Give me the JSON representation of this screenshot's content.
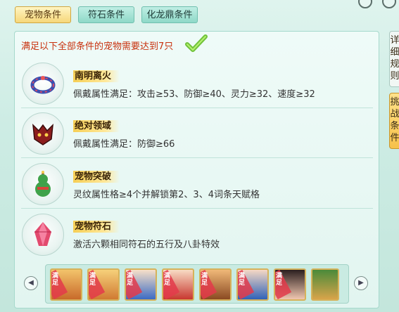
{
  "tabs": [
    {
      "label": "宠物条件",
      "active": true
    },
    {
      "label": "符石条件",
      "active": false
    },
    {
      "label": "化龙鼎条件",
      "active": false
    }
  ],
  "requirement": "满足以下全部条件的宠物需要达到7只",
  "conditions": [
    {
      "name": "南明离火",
      "desc": "佩戴属性满足：攻击≥53、防御≥40、灵力≥32、速度≥32",
      "icon": "ring-icon"
    },
    {
      "name": "绝对领域",
      "desc": "佩戴属性满足：防御≥66",
      "icon": "demon-mask-icon"
    },
    {
      "name": "宠物突破",
      "desc": "灵纹属性格≥4个并解锁第2、3、4词条天赋格",
      "icon": "gourd-icon"
    },
    {
      "name": "宠物符石",
      "desc": "激活六颗相同符石的五行及八卦特效",
      "icon": "crystal-icon"
    }
  ],
  "side_tabs": [
    {
      "label": "详细规则"
    },
    {
      "label": "挑战条件"
    }
  ],
  "pet_strip": {
    "badge": "满足",
    "pets": [
      {
        "badge": true
      },
      {
        "badge": true
      },
      {
        "badge": true
      },
      {
        "badge": true
      },
      {
        "badge": true
      },
      {
        "badge": true
      },
      {
        "badge": true
      },
      {
        "badge": false
      }
    ]
  }
}
